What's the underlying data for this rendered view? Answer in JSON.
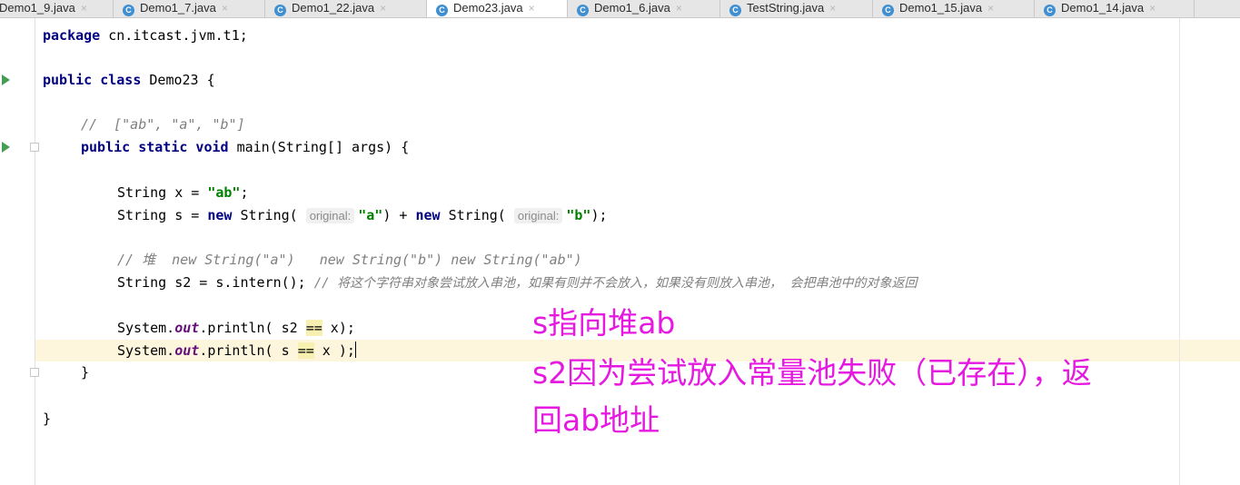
{
  "tabs": [
    {
      "label": "Demo1_9.java",
      "close": "×"
    },
    {
      "label": "Demo1_7.java",
      "close": "×"
    },
    {
      "label": "Demo1_22.java",
      "close": "×"
    },
    {
      "label": "Demo23.java",
      "close": "×"
    },
    {
      "label": "Demo1_6.java",
      "close": "×"
    },
    {
      "label": "TestString.java",
      "close": "×"
    },
    {
      "label": "Demo1_15.java",
      "close": "×"
    },
    {
      "label": "Demo1_14.java",
      "close": "×"
    }
  ],
  "tab_icon_letter": "C",
  "code": {
    "l1": {
      "kw": "package",
      "rest": " cn.itcast.jvm.t1;"
    },
    "l2": {
      "kw": "public class",
      "rest": " Demo23 {"
    },
    "l3": {
      "comment": "//  [\"ab\", \"a\", \"b\"]"
    },
    "l4": {
      "kw": "public static void",
      "rest": " main(String[] args) {"
    },
    "l5": {
      "type": "String x = ",
      "str": "\"ab\"",
      "end": ";"
    },
    "l6": {
      "pre": "String s = ",
      "kw_new1": "new",
      "mid1": " String( ",
      "hint1": "original:",
      "str1": "\"a\"",
      "mid2": ") + ",
      "kw_new2": "new",
      "mid3": " String( ",
      "hint2": "original:",
      "str2": "\"b\"",
      "end": ");"
    },
    "l7": {
      "comment": "// 堆  new String(\"a\")   new String(\"b\") new String(\"ab\")"
    },
    "l8": {
      "pre": "String s2 = s.intern(); ",
      "comment": "// 将这个字符串对象尝试放入串池，如果有则并不会放入，如果没有则放入串池， 会把串池中的对象返回"
    },
    "l9": {
      "pre": "System.",
      "field": "out",
      "mid": ".println( s2 ",
      "eq": "==",
      "end": " x);"
    },
    "l10": {
      "pre": "System.",
      "field": "out",
      "mid": ".println( s ",
      "eq": "==",
      "end": " x );"
    },
    "l11": {
      "text": "}"
    },
    "l12": {
      "text": "}"
    }
  },
  "annotation": {
    "line1": "s指向堆ab",
    "line2": "s2因为尝试放入常量池失败（已存在），返",
    "line3": "回ab地址"
  },
  "colors": {
    "annotation": "#e619e0",
    "keyword": "#000080",
    "string": "#008000",
    "comment": "#808080",
    "field": "#660e7a"
  }
}
